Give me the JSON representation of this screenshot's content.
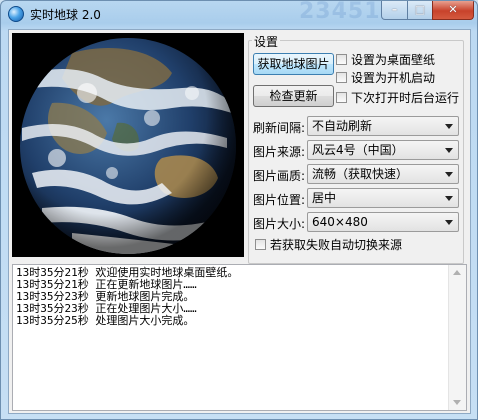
{
  "window": {
    "title": "实时地球 2.0",
    "ghost_text": "23451011"
  },
  "controls": {
    "minimize": "–",
    "maximize": "□",
    "close": "✕"
  },
  "settings": {
    "group_label": "设置",
    "get_image_button": "获取地球图片",
    "check_update_button": "检查更新",
    "checkboxes": [
      {
        "label": "设置为桌面壁纸",
        "checked": false
      },
      {
        "label": "设置为开机启动",
        "checked": false
      },
      {
        "label": "下次打开时后台运行",
        "checked": false
      }
    ],
    "rows": [
      {
        "label": "刷新间隔:",
        "value": "不自动刷新"
      },
      {
        "label": "图片来源:",
        "value": "风云4号（中国）"
      },
      {
        "label": "图片画质:",
        "value": "流畅（获取快速）"
      },
      {
        "label": "图片位置:",
        "value": "居中"
      },
      {
        "label": "图片大小:",
        "value": "640×480"
      }
    ],
    "auto_switch_checkbox": {
      "label": "若获取失败自动切换来源",
      "checked": false
    }
  },
  "log": {
    "lines": [
      "13时35分21秒 欢迎使用实时地球桌面壁纸。",
      "13时35分21秒 正在更新地球图片……",
      "13时35分23秒 更新地球图片完成。",
      "13时35分23秒 正在处理图片大小……",
      "13时35分25秒 处理图片大小完成。"
    ]
  },
  "icons": {
    "app": "earth-icon",
    "scroll_up": "scroll-up-arrow-icon",
    "scroll_down": "scroll-down-arrow-icon"
  },
  "colors": {
    "title_bar": "#b8d7f0",
    "close_button": "#c8422b",
    "client_bg": "#f0f0f0"
  }
}
